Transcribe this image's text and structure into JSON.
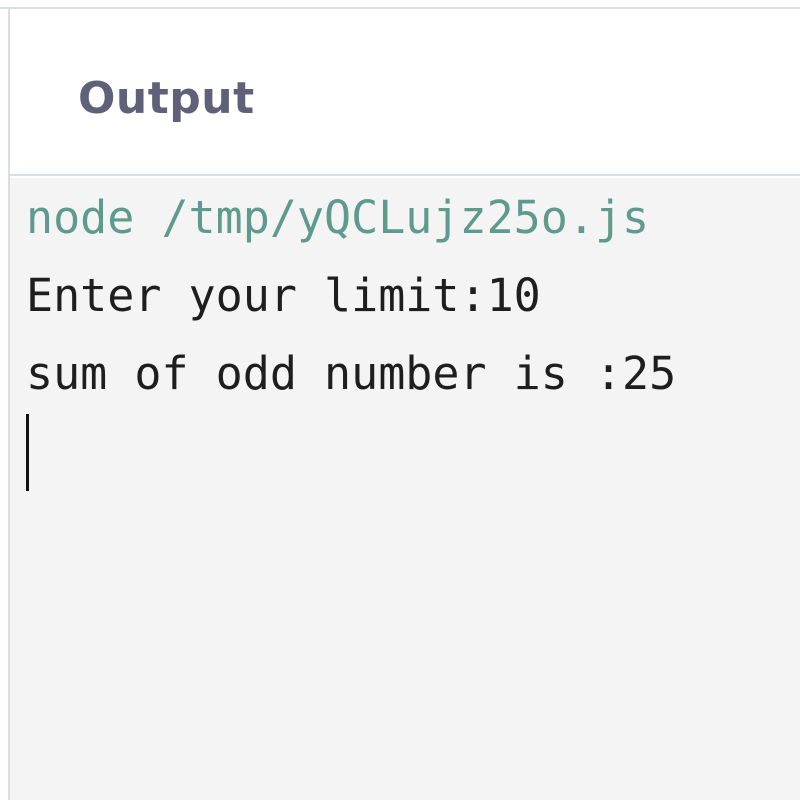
{
  "panel": {
    "title": "Output"
  },
  "console": {
    "command": "node /tmp/yQCLujz25o.js",
    "lines": [
      "Enter your limit:10",
      "sum of odd number is :25"
    ]
  }
}
